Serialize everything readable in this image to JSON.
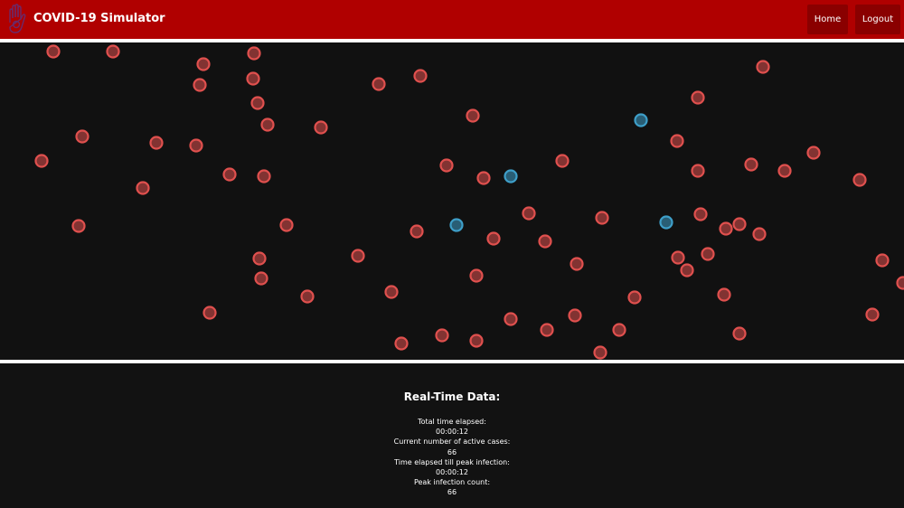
{
  "header": {
    "title": "COVID-19 Simulator",
    "home_label": "Home",
    "logout_label": "Logout"
  },
  "colors": {
    "header_bg": "#b00000",
    "button_bg": "#8a0000",
    "canvas_bg": "#111111",
    "infected": "#e0504e",
    "healthy": "#3e9fc9"
  },
  "simulation": {
    "infected_count": 66,
    "healthy_count": 4
  },
  "stats": {
    "title": "Real-Time Data:",
    "total_time_label": "Total time elapsed:",
    "total_time_value": "00:00:12",
    "active_cases_label": "Current number of active cases:",
    "active_cases_value": "66",
    "peak_time_label": "Time elapsed till peak infection:",
    "peak_time_value": "00:00:12",
    "peak_count_label": "Peak infection count:",
    "peak_count_value": "66"
  }
}
